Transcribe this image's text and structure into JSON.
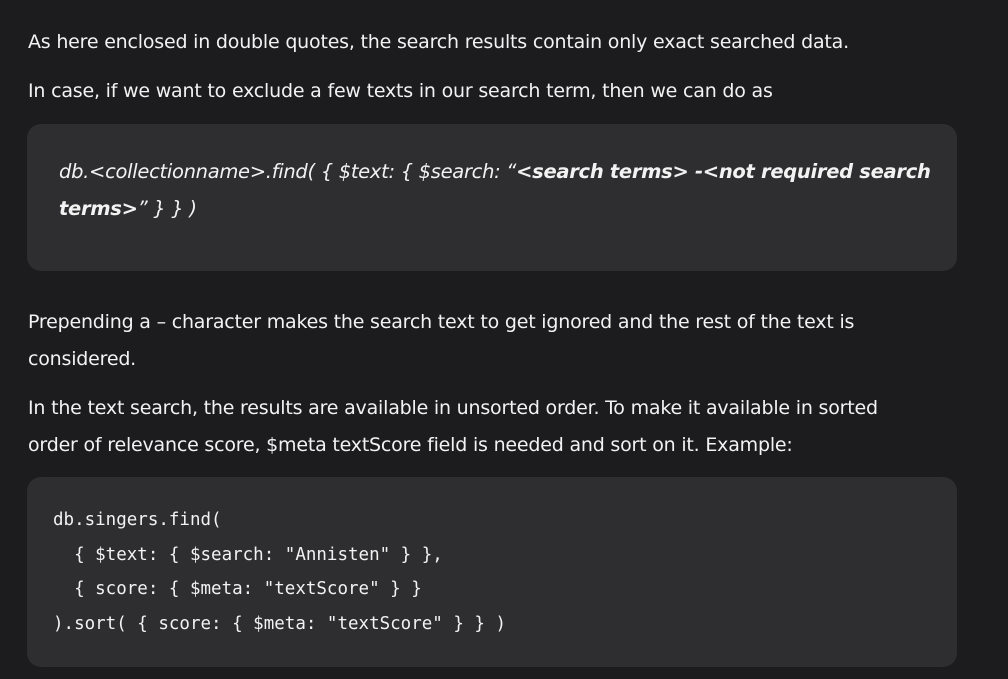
{
  "paragraphs": {
    "exact_match": "As here enclosed in double quotes, the search results contain only exact searched data.",
    "exclude_intro": "In case, if we want to exclude a few texts in our search term, then we can do as",
    "prepend_line1": "Prepending a – character makes the search text to get ignored and the rest of the text is",
    "prepend_line2": "considered.",
    "sort_line1": "In the text search, the results are available in unsorted order. To make it available in sorted",
    "sort_line2": "order of relevance score, $meta textScore field is needed and sort on it. Example:"
  },
  "exclude_block": {
    "prefix": "db.<collectionname>.find( { $text: { $search: “",
    "bold_line1": "<search terms> -<not required search",
    "bold_line2": "terms>",
    "suffix": "” } } )"
  },
  "code_example": {
    "lines": [
      "db.singers.find(",
      "  { $text: { $search: \"Annisten\" } },",
      "  { score: { $meta: \"textScore\" } }",
      ").sort( { score: { $meta: \"textScore\" } } )"
    ]
  }
}
